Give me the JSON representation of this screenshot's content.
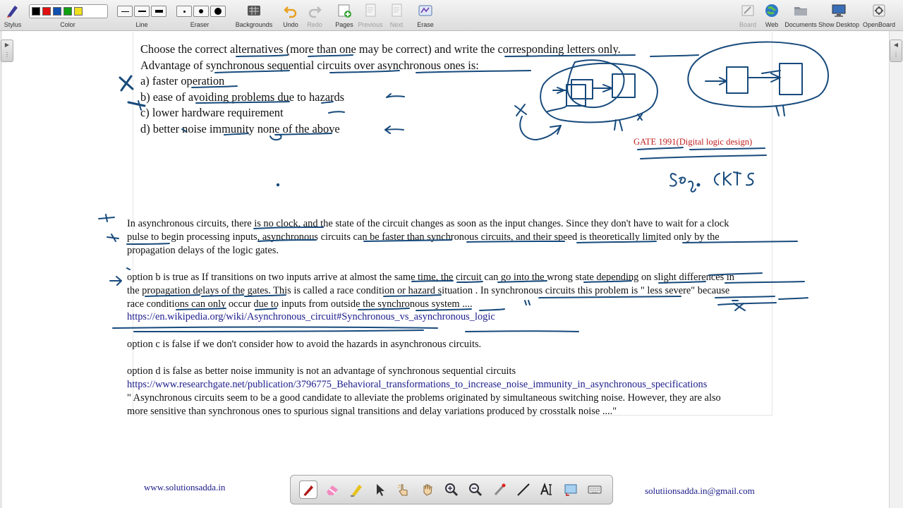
{
  "toolbar": {
    "stylus": "Stylus",
    "color": "Color",
    "line": "Line",
    "eraser": "Eraser",
    "backgrounds": "Backgrounds",
    "undo": "Undo",
    "redo": "Redo",
    "pages": "Pages",
    "previous": "Previous",
    "next": "Next",
    "erase": "Erase",
    "board": "Board",
    "web": "Web",
    "documents": "Documents",
    "show_desktop": "Show Desktop",
    "openboard": "OpenBoard",
    "swatches": [
      "#000000",
      "#e01010",
      "#1050b0",
      "#10a010",
      "#f0e020"
    ]
  },
  "question": {
    "line1": "Choose the correct alternatives (more than one may be correct) and write the corresponding letters only.",
    "line2": "Advantage of synchronous sequential circuits over asynchronous ones is:",
    "options": [
      "a) faster operation",
      "b) ease of avoiding problems due to hazards",
      "c) lower hardware requirement",
      "d) better noise immunity none of the above"
    ]
  },
  "gate_tag": "GATE 1991(Digital logic design)",
  "answer": {
    "para1": [
      "In asynchronous circuits, there is no clock, and the state of the circuit changes as soon as the input changes. Since they don't have to wait for a clock",
      "pulse to begin processing inputs, asynchronous circuits can be faster than synchronous circuits, and their speed is theoretically limited only by the",
      "propagation delays of the logic gates."
    ],
    "para2": [
      "option b is true as If transitions on two inputs arrive at almost the same time, the circuit can go into the wrong state depending on slight differences in",
      "the propagation delays of the gates. This is called a race condition or hazard situation . In synchronous circuits this problem is \" less severe\" because",
      "race conditions can only occur due to inputs from outside the synchronous system ...."
    ],
    "link1": "https://en.wikipedia.org/wiki/Asynchronous_circuit#Synchronous_vs_asynchronous_logic",
    "para3": "option c is false if we don't consider how to avoid the hazards in asynchronous circuits.",
    "para4": "option d is false as better noise immunity  is not an advantage of  synchronous sequential circuits",
    "link2": "https://www.researchgate.net/publication/3796775_Behavioral_transformations_to_increase_noise_immunity_in_asynchronous_specifications",
    "quote": [
      "\" Asynchronous circuits seem to be a good candidate to alleviate the problems originated by simultaneous switching noise. However, they are also",
      "more sensitive than synchronous ones to spurious signal transitions and delay variations produced by crosstalk noise ....\""
    ]
  },
  "footer": {
    "website": "www.solutionsadda.in",
    "email": "solutiionsadda.in@gmail.com"
  },
  "ink_color": "#174a7c"
}
